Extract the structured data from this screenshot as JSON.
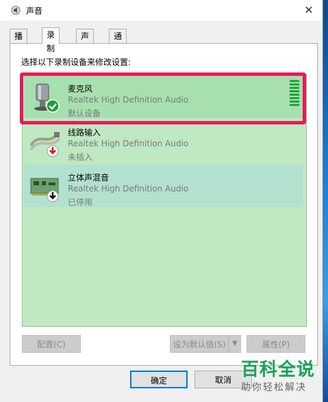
{
  "window": {
    "title": "声音"
  },
  "tabs": [
    {
      "label": "播放"
    },
    {
      "label": "录制"
    },
    {
      "label": "声音"
    },
    {
      "label": "通信"
    }
  ],
  "panel": {
    "instruction": "选择以下录制设备来修改设置:"
  },
  "devices": [
    {
      "name": "麦克风",
      "driver": "Realtek High Definition Audio",
      "status": "默认设备",
      "icon": "microphone-icon",
      "badge": "check-icon"
    },
    {
      "name": "线路输入",
      "driver": "Realtek High Definition Audio",
      "status": "未插入",
      "icon": "line-in-cable-icon",
      "badge": "red-down-arrow-icon"
    },
    {
      "name": "立体声混音",
      "driver": "Realtek High Definition Audio",
      "status": "已停用",
      "icon": "sound-card-icon",
      "badge": "black-down-arrow-icon"
    }
  ],
  "buttons": {
    "configure": "配置(C)",
    "set_default": "设为默认值(S)",
    "properties": "属性(P)",
    "ok": "确定",
    "cancel": "取消"
  },
  "watermark": {
    "brand": "百科全说",
    "slogan": "助你轻松解决"
  },
  "colors": {
    "highlight": "#e8195a",
    "level": "#1fa535",
    "list_bg": "#bfe8c3"
  }
}
